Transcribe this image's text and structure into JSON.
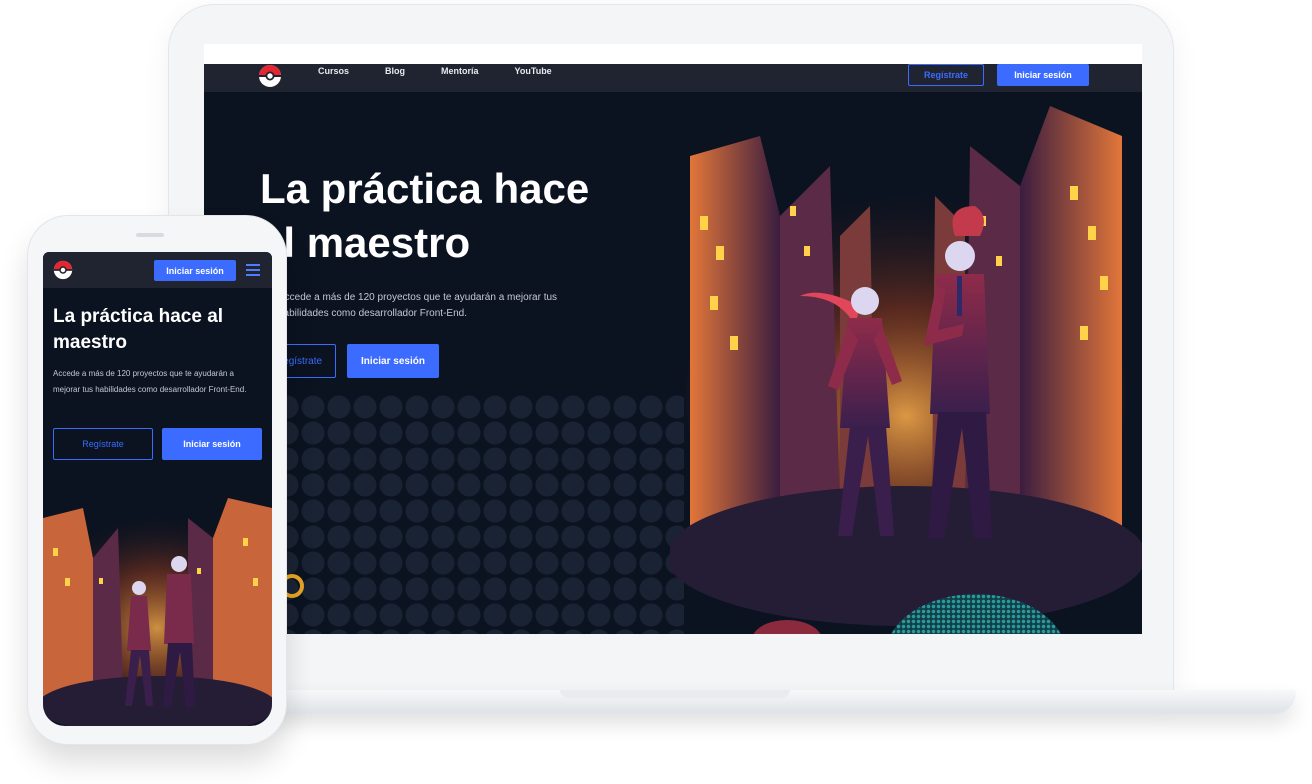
{
  "desktop": {
    "nav": {
      "links": [
        "Cursos",
        "Blog",
        "Mentoría",
        "YouTube"
      ],
      "register_label": "Regístrate",
      "login_label": "Iniciar sesión"
    },
    "hero": {
      "title_line1": "La práctica hace",
      "title_line2": "al maestro",
      "subtitle_line1": "Accede a más de 120 proyectos que te ayudarán a mejorar tus",
      "subtitle_line2": "habilidades como desarrollador Front-End.",
      "register_label": "Regístrate",
      "login_label": "Iniciar sesión"
    }
  },
  "mobile": {
    "nav": {
      "login_label": "Iniciar sesión"
    },
    "hero": {
      "title": "La práctica hace al maestro",
      "subtitle": "Accede a más de 120 proyectos que te ayudarán a mejorar tus habilidades como desarrollador Front-End.",
      "register_label": "Regístrate",
      "login_label": "Iniciar sesión"
    }
  },
  "colors": {
    "accent": "#3b6cff",
    "background": "#0b1220",
    "nav": "#1f2430"
  },
  "icons": {
    "logo": "pokeball-icon",
    "menu": "hamburger-menu-icon"
  }
}
